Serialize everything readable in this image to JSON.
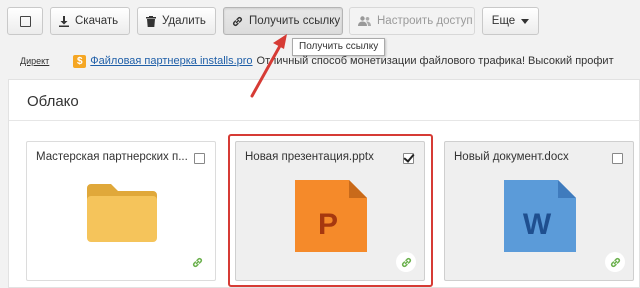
{
  "toolbar": {
    "select_all": "",
    "download_label": "Скачать",
    "delete_label": "Удалить",
    "get_link_label": "Получить ссылку",
    "access_label": "Настроить доступ",
    "more_label": "Еще"
  },
  "tooltip": "Получить ссылку",
  "ad": {
    "direct": "Директ",
    "badge": "$",
    "link": "Файловая партнерка installs.pro",
    "text": "Отличный способ монетизации файлового трафика! Высокий профит"
  },
  "panel": {
    "title": "Облако"
  },
  "files": [
    {
      "name": "Мастерская партнерских п...",
      "type": "folder",
      "checked": false,
      "selected": false
    },
    {
      "name": "Новая презентация.pptx",
      "type": "pptx",
      "checked": true,
      "selected": true,
      "icon_letter": "P"
    },
    {
      "name": "Новый документ.docx",
      "type": "docx",
      "checked": false,
      "selected": false,
      "icon_letter": "W"
    }
  ],
  "colors": {
    "highlight": "#d63b35",
    "folder": "#f5c45b",
    "pptx": "#f58a2a",
    "docx": "#5b9bd9",
    "link_icon": "#6ab04c"
  }
}
